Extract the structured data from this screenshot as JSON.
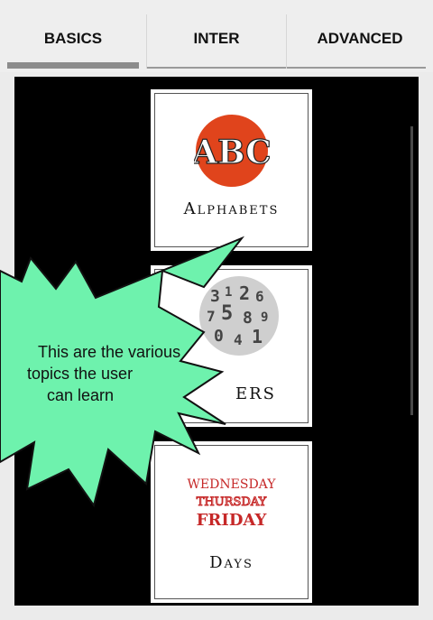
{
  "tabs": [
    {
      "label": "BASICS",
      "active": true
    },
    {
      "label": "INTER",
      "active": false
    },
    {
      "label": "ADVANCED",
      "active": false
    }
  ],
  "topics": [
    {
      "title": "Alphabets",
      "icon": "abc-icon",
      "icon_text": "ABC"
    },
    {
      "title": "Numbers",
      "icon": "numbers-icon",
      "visible_title": "ERS"
    },
    {
      "title": "Days",
      "icon": "days-icon",
      "icon_lines": [
        "WEDNESDAY",
        "THURSDAY",
        "FRIDAY"
      ]
    }
  ],
  "callout": {
    "line1": "This are the various",
    "line2": "topics the user",
    "line3": "can learn",
    "color": "#6ef2ad"
  },
  "colors": {
    "abc_circle": "#e0441c",
    "days_text": "#c62828"
  }
}
